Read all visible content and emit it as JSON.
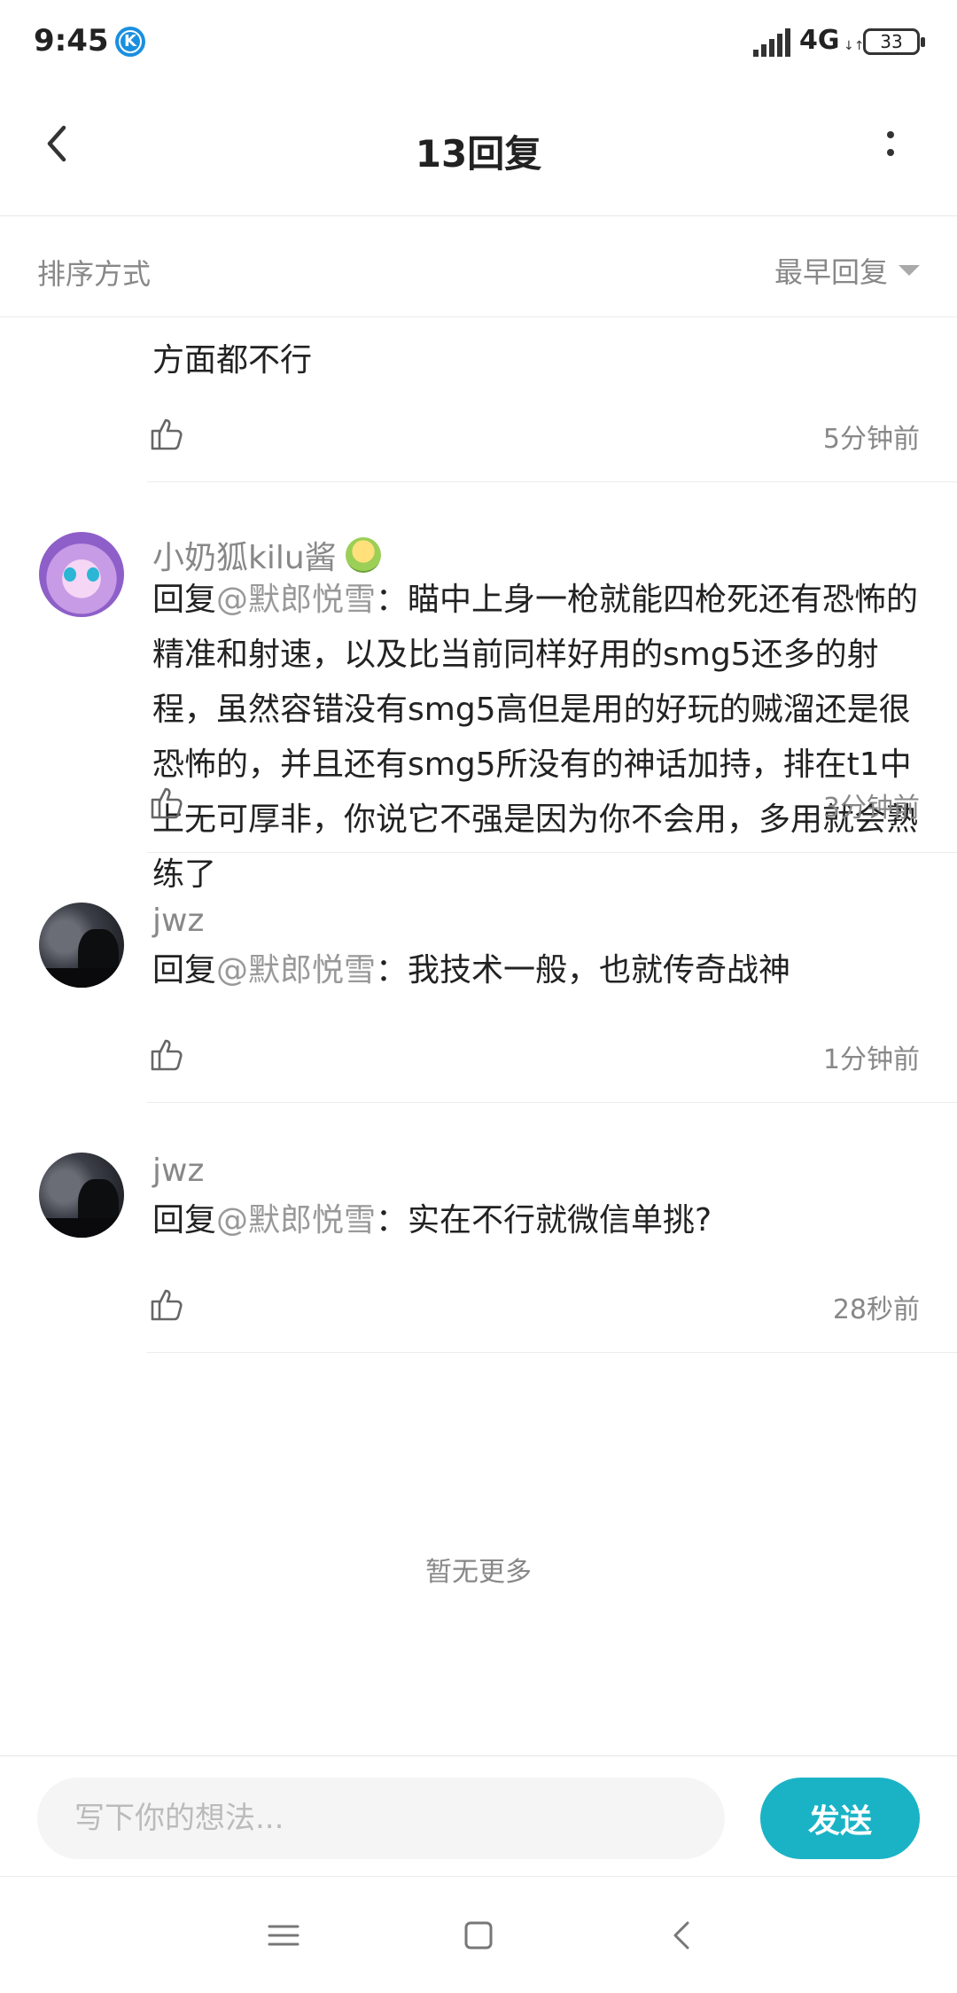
{
  "status_bar": {
    "time": "9:45",
    "app_icon": "k-app-icon",
    "network": "4G",
    "battery": "33"
  },
  "header": {
    "title": "13回复",
    "back_icon": "chevron-left-icon",
    "more_icon": "more-vertical-icon"
  },
  "sort": {
    "label": "排序方式",
    "selected": "最早回复"
  },
  "comments": [
    {
      "text": "方面都不行",
      "time": "5分钟前"
    },
    {
      "username": "小奶狐kilu酱",
      "reply_prefix": "回复",
      "mention": "@默郎悦雪",
      "text": "：瞄中上身一枪就能四枪死还有恐怖的精准和射速，以及比当前同样好用的smg5还多的射程，虽然容错没有smg5高但是用的好玩的贼溜还是很恐怖的，并且还有smg5所没有的神话加持，排在t1中上无可厚非，你说它不强是因为你不会用，多用就会熟练了",
      "time": "3分钟前"
    },
    {
      "username": "jwz",
      "reply_prefix": "回复",
      "mention": "@默郎悦雪",
      "text": "：我技术一般，也就传奇战神",
      "time": "1分钟前"
    },
    {
      "username": "jwz",
      "reply_prefix": "回复",
      "mention": "@默郎悦雪",
      "text": "：实在不行就微信单挑?",
      "time": "28秒前"
    }
  ],
  "footer_note": "暂无更多",
  "input": {
    "placeholder": "写下你的想法...",
    "value": "",
    "send_label": "发送"
  },
  "colors": {
    "accent": "#1ab3c6",
    "secondary_text": "#888888",
    "primary_text": "#222222"
  }
}
